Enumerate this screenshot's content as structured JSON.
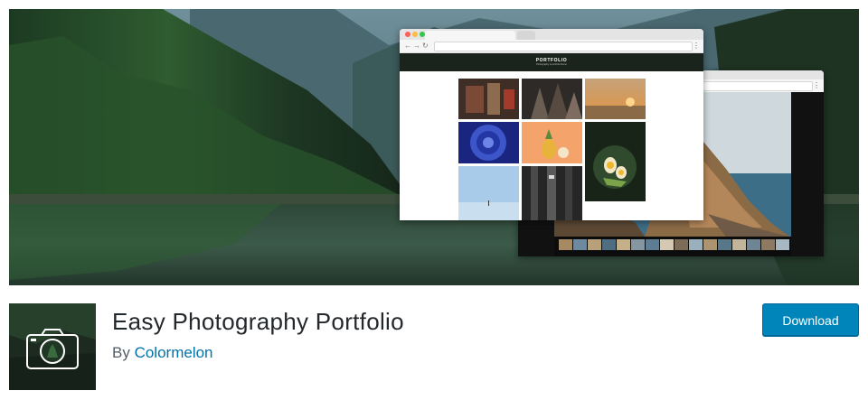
{
  "banner": {
    "mockup": {
      "site_title": "PORTFOLIO",
      "site_tagline": "Photography & portfolio theme"
    }
  },
  "plugin": {
    "name": "Easy Photography Portfolio",
    "by_prefix": "By",
    "author": "Colormelon",
    "download_label": "Download"
  },
  "colors": {
    "link": "#0073aa",
    "button": "#0085ba",
    "title": "#23282d"
  }
}
